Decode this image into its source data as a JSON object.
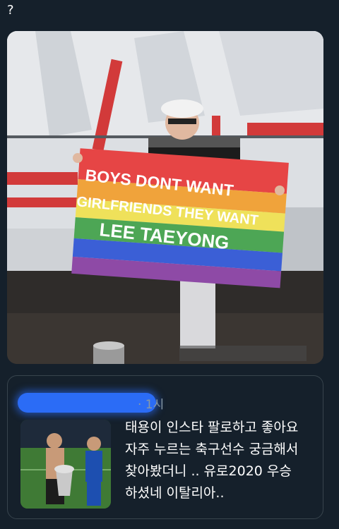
{
  "tweet": {
    "text": "?"
  },
  "flag": {
    "line1": "BOYS DONT WANT",
    "line2": "GIRLFRIENDS THEY WANT",
    "line3": "LEE TAEYONG"
  },
  "quote": {
    "meta": "· 1시",
    "lines": [
      "태용이 인스타 팔로하고 좋아요",
      "자주 누르는 축구선수 궁금해서",
      "찾아봤더니 .. 유로2020 우승",
      "하셨네 이탈리아.."
    ]
  },
  "colors": {
    "background": "#15202b",
    "border": "#38444d",
    "muted_text": "#8899a6",
    "redaction_blue": "#2b6cf6"
  }
}
